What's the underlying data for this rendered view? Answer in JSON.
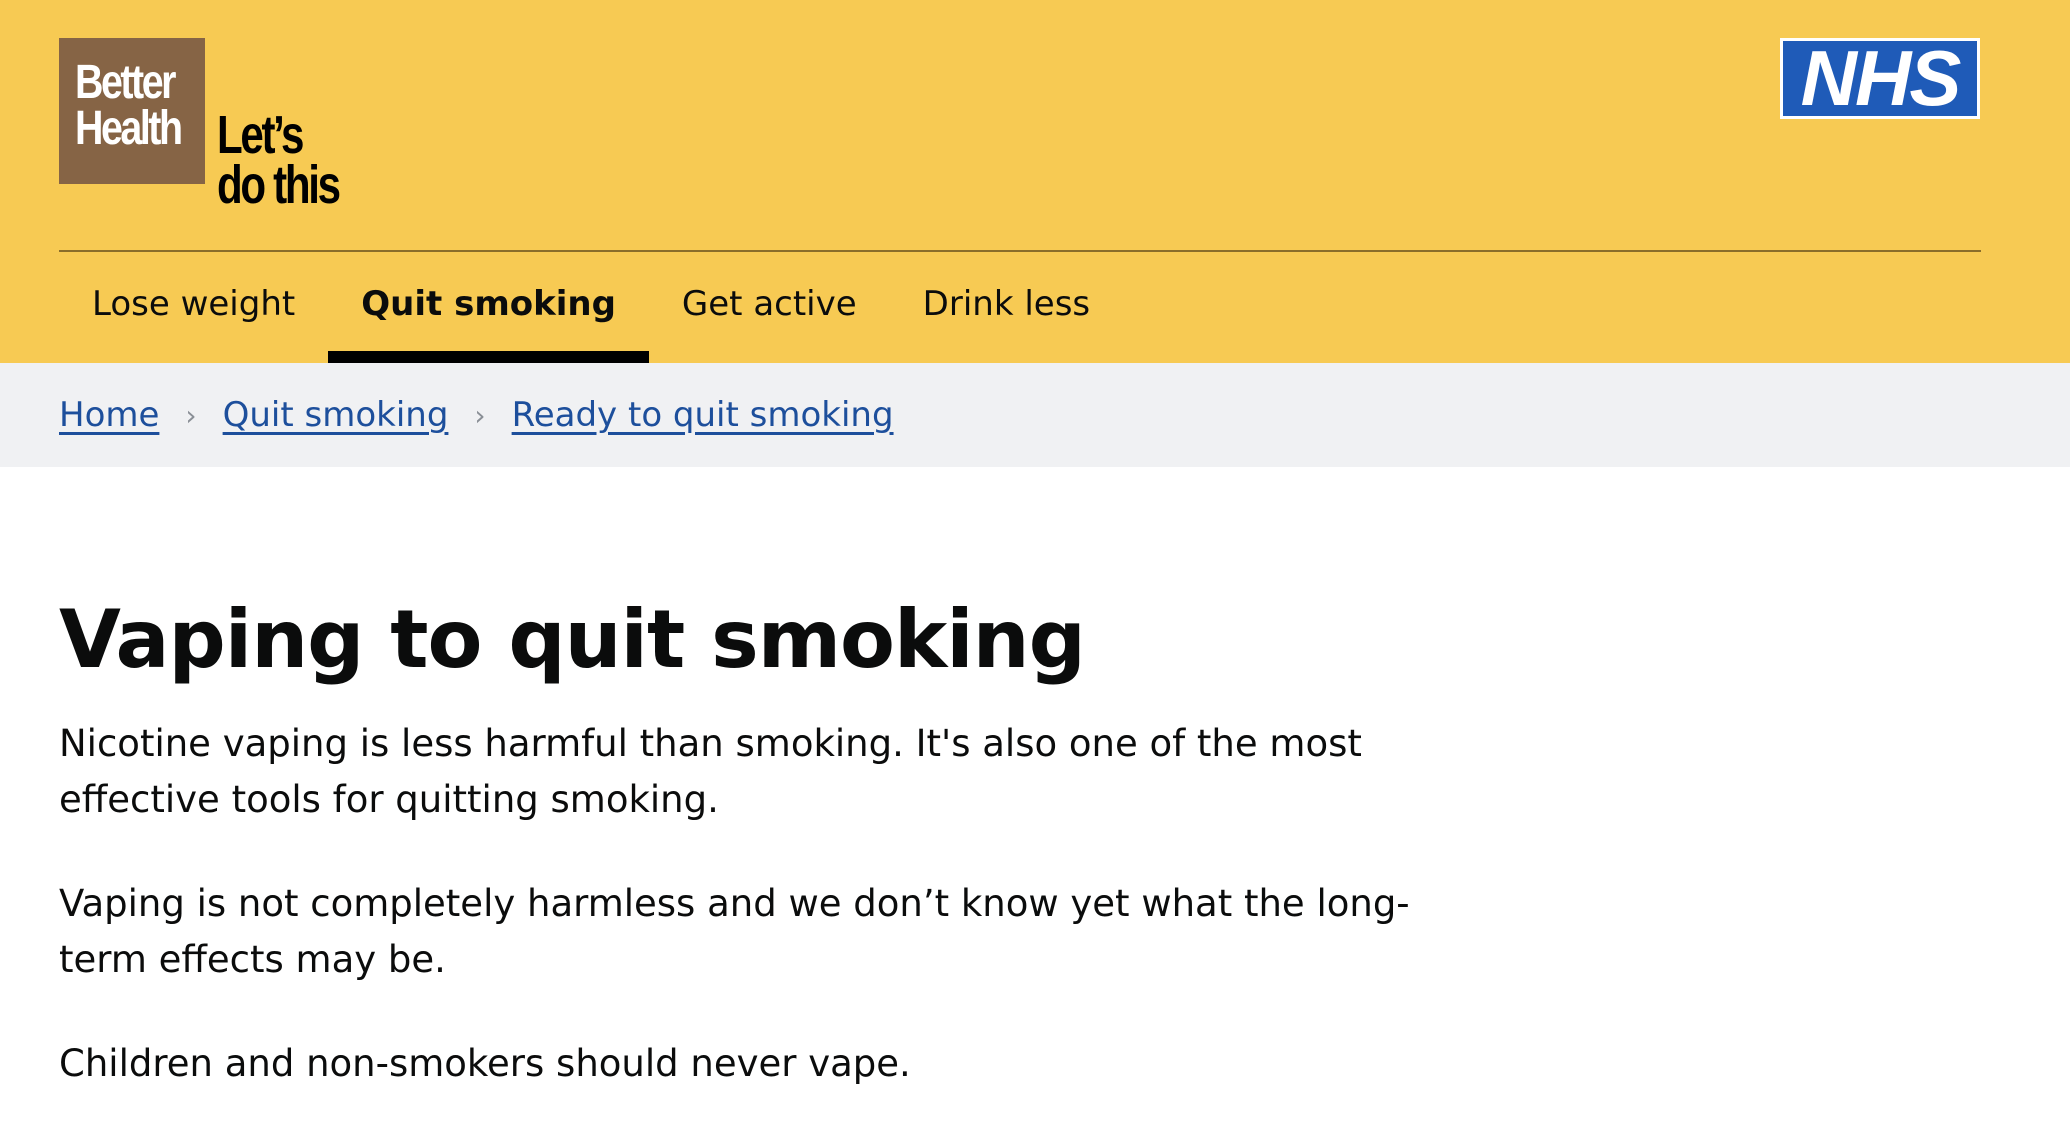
{
  "header": {
    "brand_line1": "Better",
    "brand_line2": "Health",
    "tagline_line1": "Let’s",
    "tagline_line2": "do this",
    "nhs_logo_text": "NHS",
    "colors": {
      "header_bg": "#f7ca53",
      "brand_box": "#866445",
      "nhs_blue": "#1f5bb8"
    }
  },
  "nav": {
    "items": [
      {
        "label": "Lose weight",
        "active": false
      },
      {
        "label": "Quit smoking",
        "active": true
      },
      {
        "label": "Get active",
        "active": false
      },
      {
        "label": "Drink less",
        "active": false
      }
    ]
  },
  "breadcrumb": {
    "items": [
      {
        "label": "Home"
      },
      {
        "label": "Quit smoking"
      },
      {
        "label": "Ready to quit smoking"
      }
    ],
    "separator": "›",
    "link_color": "#1d4f9c"
  },
  "main": {
    "title": "Vaping to quit smoking",
    "paragraphs": [
      "Nicotine vaping is less harmful than smoking. It's also one of the most effective tools for quitting smoking.",
      "Vaping is not completely harmless and we don’t know yet what the long-term effects may be.",
      "Children and non-smokers should never vape."
    ]
  }
}
